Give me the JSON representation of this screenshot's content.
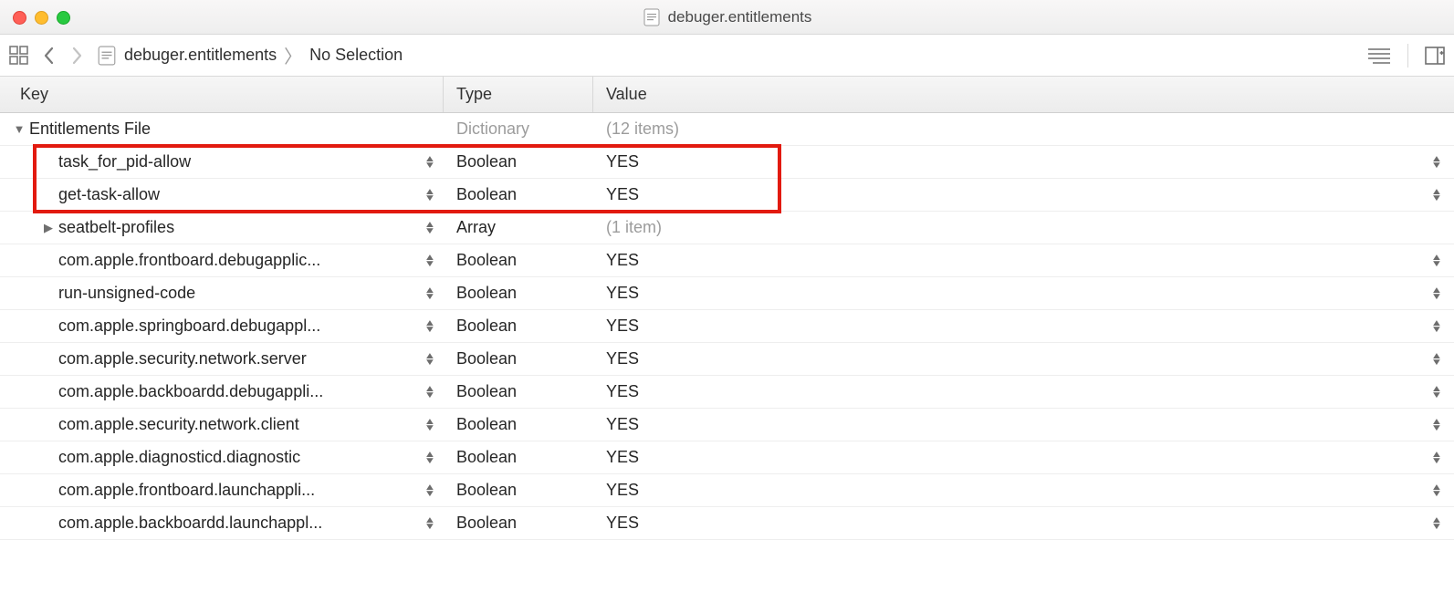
{
  "titlebar": {
    "filename": "debuger.entitlements"
  },
  "jumpbar": {
    "crumb_file": "debuger.entitlements",
    "crumb_selection": "No Selection"
  },
  "columns": {
    "key": "Key",
    "type": "Type",
    "value": "Value"
  },
  "root": {
    "key": "Entitlements File",
    "type": "Dictionary",
    "value": "(12 items)"
  },
  "rows": [
    {
      "key": "task_for_pid-allow",
      "type": "Boolean",
      "value": "YES",
      "expandable": false
    },
    {
      "key": "get-task-allow",
      "type": "Boolean",
      "value": "YES",
      "expandable": false
    },
    {
      "key": "seatbelt-profiles",
      "type": "Array",
      "value": "(1 item)",
      "value_dim": true,
      "expandable": true
    },
    {
      "key": "com.apple.frontboard.debugapplic...",
      "type": "Boolean",
      "value": "YES",
      "expandable": false
    },
    {
      "key": "run-unsigned-code",
      "type": "Boolean",
      "value": "YES",
      "expandable": false
    },
    {
      "key": "com.apple.springboard.debugappl...",
      "type": "Boolean",
      "value": "YES",
      "expandable": false
    },
    {
      "key": "com.apple.security.network.server",
      "type": "Boolean",
      "value": "YES",
      "expandable": false
    },
    {
      "key": "com.apple.backboardd.debugappli...",
      "type": "Boolean",
      "value": "YES",
      "expandable": false
    },
    {
      "key": "com.apple.security.network.client",
      "type": "Boolean",
      "value": "YES",
      "expandable": false
    },
    {
      "key": "com.apple.diagnosticd.diagnostic",
      "type": "Boolean",
      "value": "YES",
      "expandable": false
    },
    {
      "key": "com.apple.frontboard.launchappli...",
      "type": "Boolean",
      "value": "YES",
      "expandable": false
    },
    {
      "key": "com.apple.backboardd.launchappl...",
      "type": "Boolean",
      "value": "YES",
      "expandable": false
    }
  ],
  "highlight": {
    "start_row": 0,
    "end_row": 1
  }
}
